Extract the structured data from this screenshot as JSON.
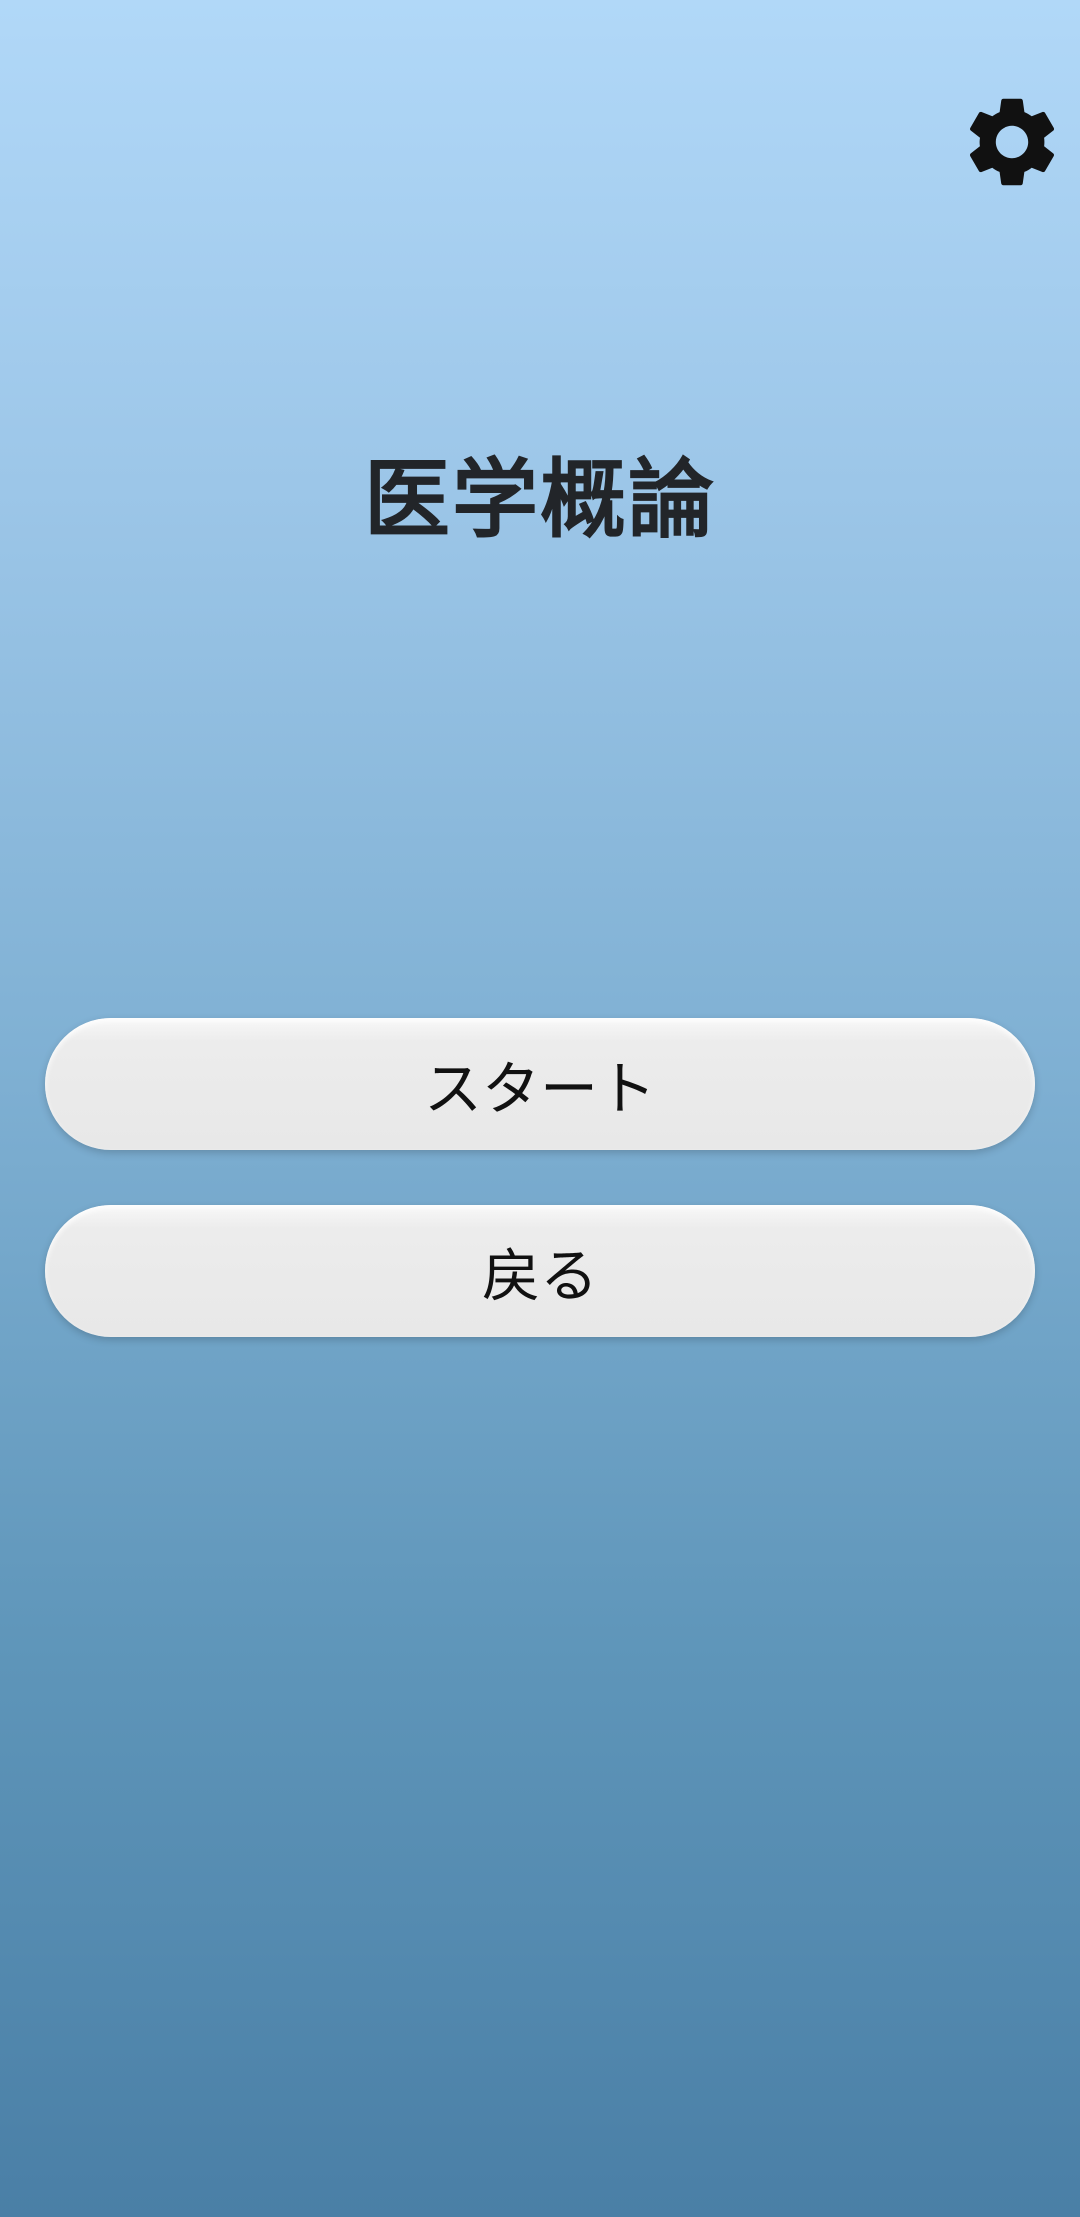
{
  "app": {
    "title": "医学概論"
  },
  "toolbar": {
    "settings_icon": "gear-icon"
  },
  "actions": {
    "start_label": "スタート",
    "back_label": "戻る"
  },
  "colors": {
    "background_top": "#b1d8f8",
    "background_bottom": "#4a7fa6",
    "title_text": "#222529",
    "button_bg": "#e8e8e8",
    "button_text": "#111111",
    "icon": "#111111"
  }
}
